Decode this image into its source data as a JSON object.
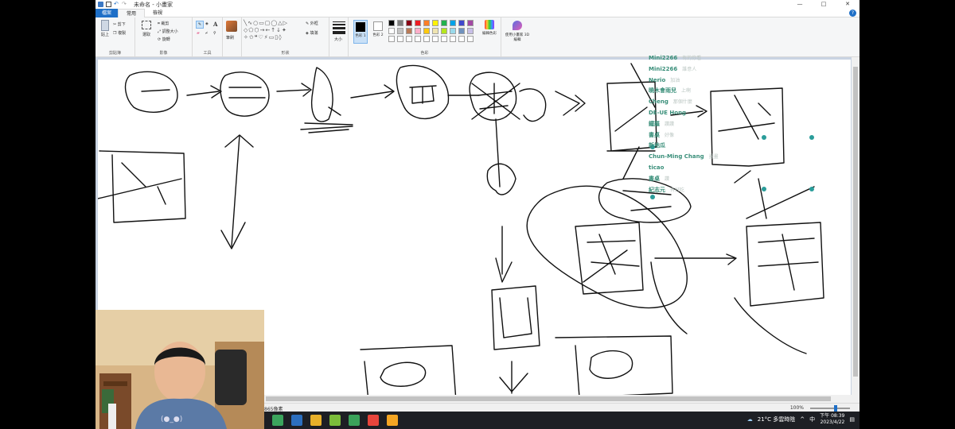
{
  "titlebar": {
    "title": "未命名 - 小畫家"
  },
  "window_controls": {
    "minimize": "—",
    "maximize": "□",
    "close": "✕"
  },
  "tabs": {
    "file": "檔案",
    "home": "常用",
    "view": "檢視"
  },
  "help_label": "?",
  "ribbon": {
    "clipboard": {
      "paste": "貼上",
      "cut": "剪下",
      "copy": "複製",
      "group": "剪貼簿"
    },
    "image": {
      "select": "選取",
      "crop": "裁剪",
      "resize": "調整大小",
      "rotate": "旋轉",
      "group": "影像"
    },
    "tools": {
      "group": "工具",
      "text_tool": "A"
    },
    "brushes": {
      "label": "筆刷"
    },
    "shapes": {
      "outline": "外框",
      "fill": "填滿",
      "group": "形狀"
    },
    "size": {
      "label": "大小"
    },
    "colors": {
      "color1": "色彩 1",
      "color2": "色彩 2",
      "edit": "編輯色彩",
      "group": "色彩",
      "palette_row1": [
        "#000000",
        "#7f7f7f",
        "#880015",
        "#ed1c24",
        "#ff7f27",
        "#fff200",
        "#22b14c",
        "#00a2e8",
        "#3f48cc",
        "#a349a4"
      ],
      "palette_row2": [
        "#ffffff",
        "#c3c3c3",
        "#b97a57",
        "#ffaec9",
        "#ffc90e",
        "#efe4b0",
        "#b5e61d",
        "#99d9ea",
        "#7092be",
        "#c8bfe7"
      ]
    },
    "paint3d": {
      "label": "使用小畫家 3D 編輯"
    }
  },
  "chat": [
    {
      "name": "Mini2266",
      "msg": "有的你看"
    },
    {
      "name": "Mini2266",
      "msg": "誰意人"
    },
    {
      "name": "Nerio",
      "msg": "加油"
    },
    {
      "name": "曉木會雨兒",
      "msg": "上啊"
    },
    {
      "name": "Cheng",
      "msg": "那個什麼"
    },
    {
      "name": "DE-UE Hong",
      "msg": ""
    },
    {
      "name": "鐵羅",
      "msg": "讚讚"
    },
    {
      "name": "書桌",
      "msg": "好像"
    },
    {
      "name": "新地瓜",
      "msg": ""
    },
    {
      "name": "Chun-Ming Chang",
      "msg": "畫畫"
    },
    {
      "name": "ticao",
      "msg": ""
    },
    {
      "name": "書桌",
      "msg": "讚"
    },
    {
      "name": "紀志元",
      "msg": "有好吃"
    }
  ],
  "statusbar": {
    "size": "865像素",
    "zoom": "100%"
  },
  "taskbar": {
    "weather": "21°C 多雲時陰",
    "ime": "中",
    "time": "下午 08:39",
    "date": "2023/4/22",
    "icons": [
      "#3ba55d",
      "#2c6fbf",
      "#e9b12a",
      "#7bbd3a",
      "#3aa35a",
      "#e8453c",
      "#f5a623"
    ]
  }
}
